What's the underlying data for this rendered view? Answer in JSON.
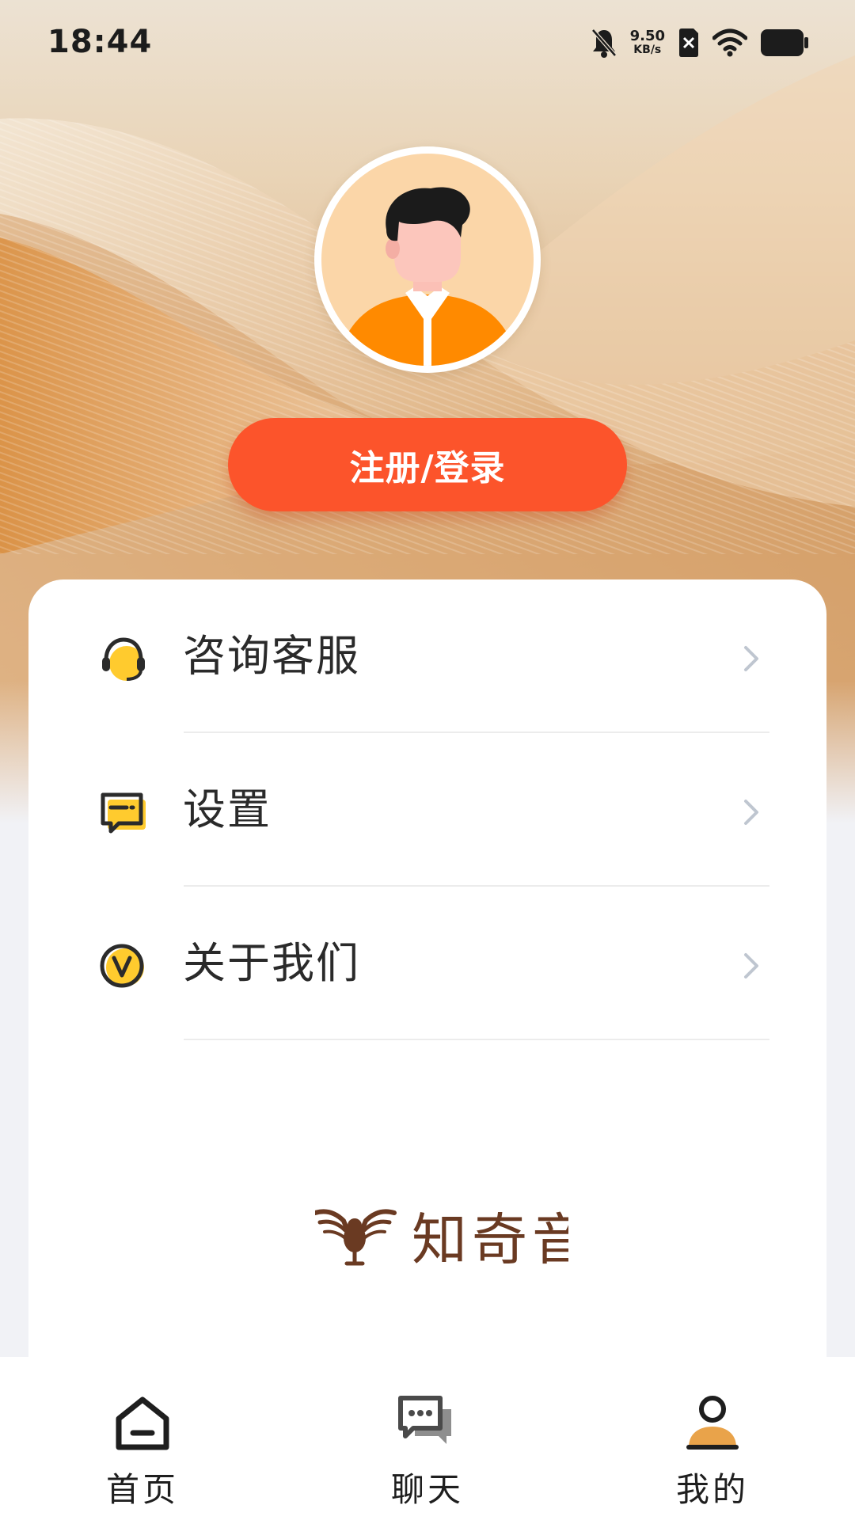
{
  "status_bar": {
    "time": "18:44",
    "net_speed_value": "9.50",
    "net_speed_unit": "KB/s",
    "icons": [
      "bell-off-icon",
      "sim-off-icon",
      "wifi-icon",
      "battery-icon"
    ]
  },
  "profile": {
    "avatar_icon": "default-avatar-icon",
    "login_label": "注册/登录"
  },
  "menu": {
    "items": [
      {
        "label": "咨询客服",
        "icon": "headset-icon"
      },
      {
        "label": "设置",
        "icon": "message-settings-icon"
      },
      {
        "label": "关于我们",
        "icon": "v-badge-icon"
      }
    ]
  },
  "brand": {
    "logo_text": "知奇音",
    "logo_icon": "eagle-logo-icon"
  },
  "bottom_nav": {
    "items": [
      {
        "label": "首页",
        "icon": "home-icon",
        "active": false
      },
      {
        "label": "聊天",
        "icon": "chat-icon",
        "active": false
      },
      {
        "label": "我的",
        "icon": "profile-icon",
        "active": true
      }
    ]
  },
  "colors": {
    "accent": "#fc542b",
    "icon_yellow": "#ffcb2e",
    "icon_dark": "#2b2b2b",
    "profile_orange": "#e9a34a",
    "brand_brown": "#6a3a22"
  }
}
